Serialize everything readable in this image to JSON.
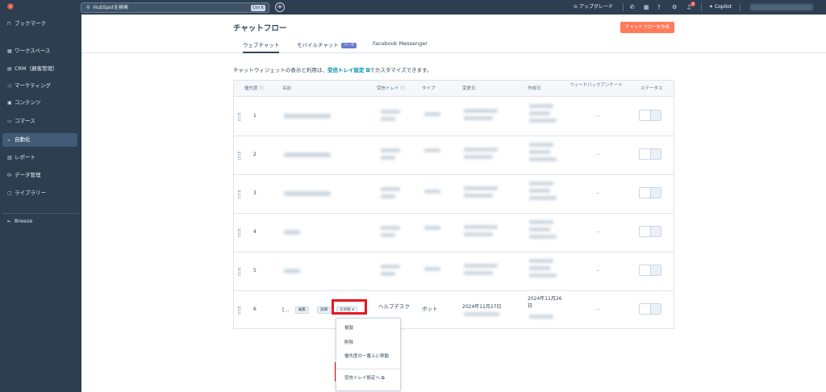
{
  "topbar": {
    "search_placeholder": "HubSpotを検索",
    "shortcut": "Ctrl K",
    "upgrade_label": "アップグレード",
    "copilot_label": "Copilot",
    "notification_count": "4"
  },
  "sidebar": {
    "items": [
      {
        "label": "ブックマーク",
        "icon": "bookmark-icon",
        "glyph": "⊓"
      },
      {
        "label": "ワークスペース",
        "icon": "workspace-icon",
        "glyph": "▦"
      },
      {
        "label": "CRM（顧客管理）",
        "icon": "crm-icon",
        "glyph": "▤"
      },
      {
        "label": "マーケティング",
        "icon": "marketing-icon",
        "glyph": "◁"
      },
      {
        "label": "コンテンツ",
        "icon": "content-icon",
        "glyph": "▣"
      },
      {
        "label": "コマース",
        "icon": "commerce-icon",
        "glyph": "▭"
      },
      {
        "label": "自動化",
        "icon": "automation-icon",
        "glyph": "⟑"
      },
      {
        "label": "レポート",
        "icon": "reports-icon",
        "glyph": "▥"
      },
      {
        "label": "データ管理",
        "icon": "data-management-icon",
        "glyph": "⛁"
      },
      {
        "label": "ライブラリー",
        "icon": "library-icon",
        "glyph": "▢"
      },
      {
        "label": "Breeze",
        "icon": "breeze-icon",
        "glyph": "⇤"
      }
    ],
    "active_index": 6
  },
  "page": {
    "title": "チャットフロー",
    "create_button": "チャットフローを作成",
    "tabs": [
      {
        "label": "ウェブチャット",
        "active": true
      },
      {
        "label": "モバイルチャット",
        "badge": "ベータ"
      },
      {
        "label": "Facebook Messenger"
      }
    ],
    "description_prefix": "チャットウィジェットの表示と利用は、",
    "description_link": "受信トレイ設定",
    "description_suffix": "でカスタマイズできます。"
  },
  "table": {
    "headers": [
      "優先度",
      "名前",
      "受信トレイ",
      "タイプ",
      "変更日",
      "作成日",
      "フィードバックアンケート",
      "ステータス"
    ],
    "rows": [
      {
        "priority": "1",
        "feedback": "--"
      },
      {
        "priority": "2",
        "feedback": "--"
      },
      {
        "priority": "3",
        "feedback": "--"
      },
      {
        "priority": "4",
        "feedback": "--"
      },
      {
        "priority": "5",
        "feedback": "--"
      },
      {
        "priority": "6",
        "name": "[...",
        "edit": "編集",
        "details": "詳細",
        "more": "その他",
        "inbox": "ヘルプデスク",
        "type": "ボット",
        "modified": "2024年11月27日",
        "created": "2024年11月26日",
        "feedback": "--"
      }
    ]
  },
  "dropdown": {
    "items": [
      "複製",
      "削除",
      "優先度の一番上に移動"
    ],
    "inbox_settings": "受信トレイ設定へ"
  },
  "colors": {
    "nav_bg": "#2d3e50",
    "accent": "#ff7a59",
    "link": "#0091ae",
    "highlight": "#e8171f",
    "beta": "#6a78d1"
  }
}
